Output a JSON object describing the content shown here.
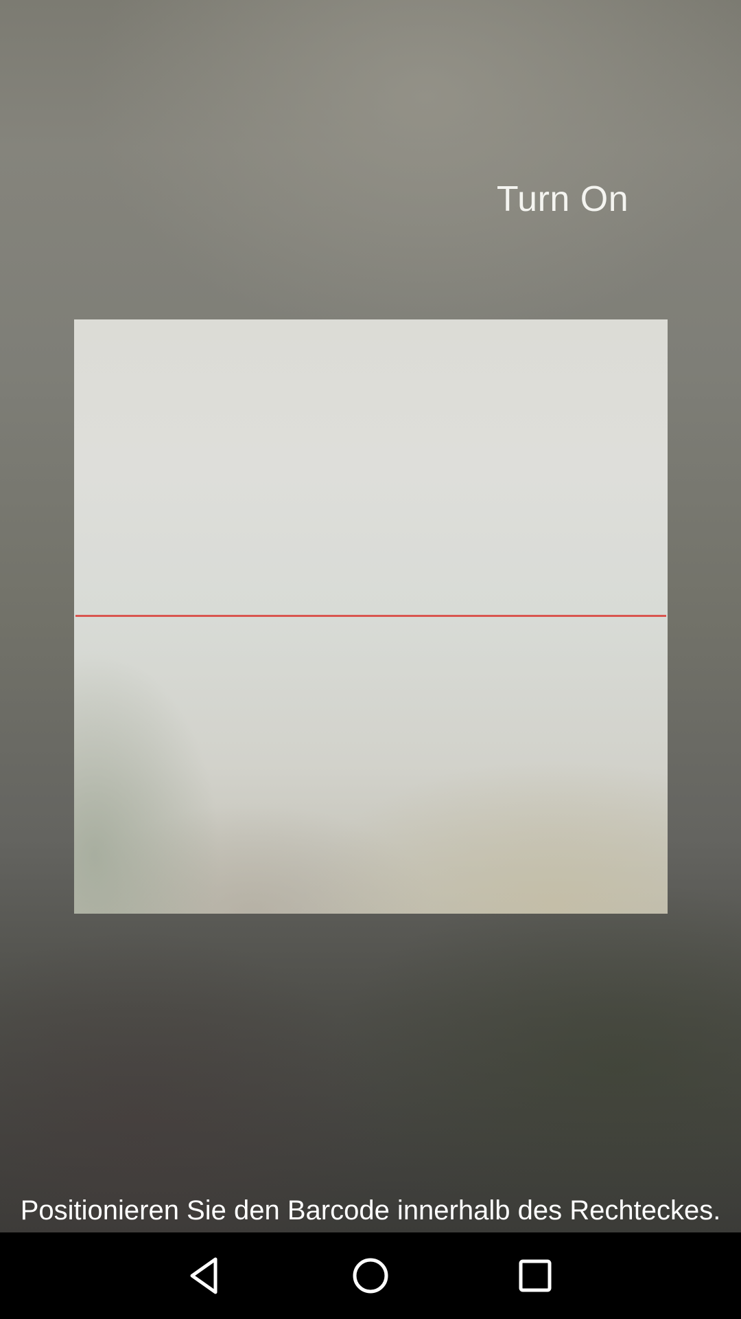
{
  "flashlight": {
    "toggle_label": "Turn On"
  },
  "scanner": {
    "hint": "Positionieren Sie den Barcode innerhalb des Rechteckes.",
    "scan_line_color": "#d9554f"
  },
  "navigation": {
    "icons": [
      "back-icon",
      "home-icon",
      "recents-icon"
    ]
  }
}
